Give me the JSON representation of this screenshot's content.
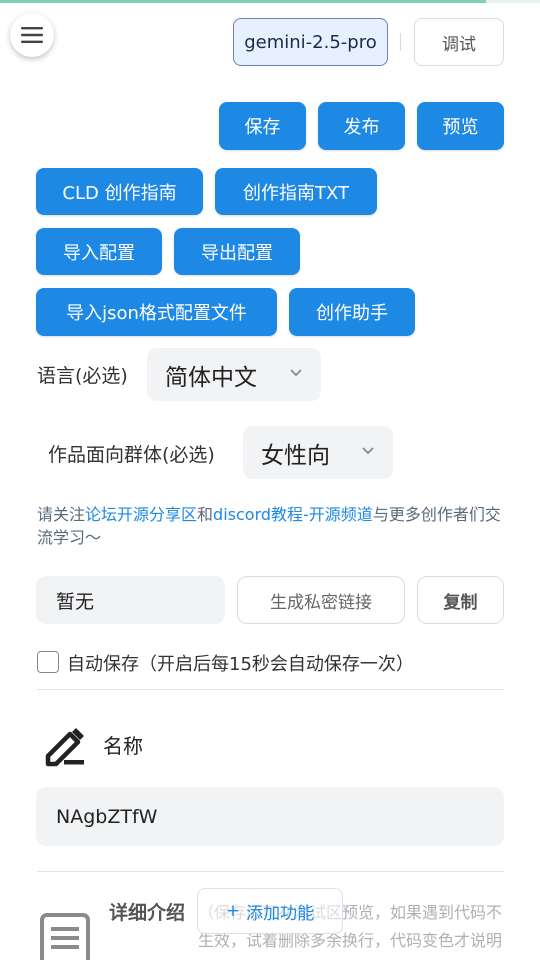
{
  "header": {
    "model": "gemini-2.5-pro",
    "debug_label": "调试"
  },
  "toolbar": {
    "save": "保存",
    "publish": "发布",
    "preview": "预览"
  },
  "actions": {
    "cld_guide": "CLD 创作指南",
    "guide_txt": "创作指南TXT",
    "import_config": "导入配置",
    "export_config": "导出配置",
    "import_json": "导入json格式配置文件",
    "assistant": "创作助手"
  },
  "language": {
    "label": "语言(必选)",
    "value": "简体中文"
  },
  "audience": {
    "label": "作品面向群体(必选)",
    "value": "女性向"
  },
  "notice": {
    "prefix": "请关注",
    "link1": "论坛开源分享区",
    "mid": "和",
    "link2": "discord教程-开源频道",
    "suffix": "与更多创作者们交流学习～"
  },
  "private_link": {
    "value": "暂无",
    "generate_label": "生成私密链接",
    "copy_label": "复制"
  },
  "autosave": {
    "label": "自动保存（开启后每15秒会自动保存一次）",
    "checked": false
  },
  "name_section": {
    "title": "名称",
    "value": "NAgbZTfW",
    "icon": "pen-icon"
  },
  "detail_section": {
    "title": "详细介绍",
    "hint": "（保存后可在测试区预览，如果遇到代码不生效，试着删除多余换行，代码变色才说明生",
    "add_feature": "添加功能",
    "icon": "document-icon"
  }
}
